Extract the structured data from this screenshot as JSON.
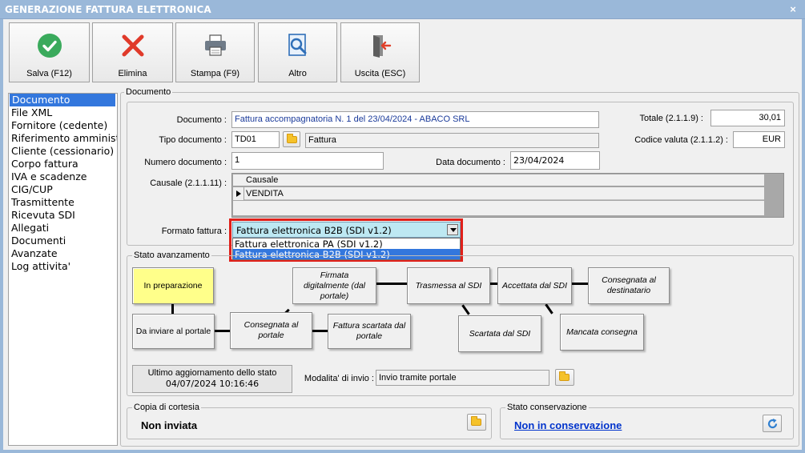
{
  "window": {
    "title": "GENERAZIONE FATTURA ELETTRONICA",
    "close": "×"
  },
  "toolbar": [
    {
      "label": "Salva (F12)",
      "icon": "check-circle"
    },
    {
      "label": "Elimina",
      "icon": "x-mark"
    },
    {
      "label": "Stampa (F9)",
      "icon": "printer"
    },
    {
      "label": "Altro",
      "icon": "search-document"
    },
    {
      "label": "Uscita (ESC)",
      "icon": "exit-door"
    }
  ],
  "nav": [
    "Documento",
    "File XML",
    "Fornitore (cedente)",
    "Riferimento amministrativo",
    "Cliente (cessionario)",
    "Corpo fattura",
    "IVA e scadenze",
    "CIG/CUP",
    "Trasmittente",
    "Ricevuta SDI",
    "Allegati",
    "Documenti",
    "Avanzate",
    "Log attivita'"
  ],
  "documento": {
    "legend": "Documento",
    "documento_label": "Documento :",
    "documento_value": "Fattura accompagnatoria N. 1 del 23/04/2024 - ABACO SRL",
    "tipo_label": "Tipo documento :",
    "tipo_code": "TD01",
    "tipo_desc": "Fattura",
    "numero_label": "Numero documento :",
    "numero_value": "1",
    "data_label": "Data documento :",
    "data_value": "23/04/2024",
    "totale_label": "Totale (2.1.1.9) :",
    "totale_value": "30,01",
    "valuta_label": "Codice valuta (2.1.1.2) :",
    "valuta_value": "EUR",
    "causale_label": "Causale (2.1.1.11) :",
    "causale_header": "Causale",
    "causale_row": "VENDITA",
    "formato_label": "Formato fattura :",
    "formato_value": "Fattura elettronica B2B (SDI v1.2)",
    "formato_options": [
      "Fattura elettronica PA (SDI v1.2)",
      "Fattura elettronica B2B (SDI v1.2)"
    ]
  },
  "stato": {
    "legend": "Stato avanzamento",
    "steps": {
      "in_preparazione": "In preparazione",
      "da_inviare": "Da inviare al portale",
      "consegnata_portale": "Consegnata al portale",
      "firmata": "Firmata digitalmente (dal portale)",
      "scartata_portale": "Fattura scartata dal portale",
      "trasmessa": "Trasmessa al SDI",
      "scartata_sdi": "Scartata dal SDI",
      "accettata": "Accettata dal SDI",
      "mancata": "Mancata consegna",
      "consegnata_dest": "Consegnata al destinatario"
    },
    "ultimo_label": "Ultimo aggiornamento dello stato",
    "ultimo_value": "04/07/2024 10:16:46",
    "modalita_label": "Modalita' di invio :",
    "modalita_value": "Invio tramite portale"
  },
  "copia": {
    "legend": "Copia di cortesia",
    "value": "Non inviata"
  },
  "conservazione": {
    "legend": "Stato conservazione",
    "value": "Non in conservazione"
  },
  "colors": {
    "title_bar": "#9ab8d9",
    "selection": "#3377dd",
    "active_step": "#ffff8a",
    "dropdown_bg": "#bde8f2",
    "highlight_border": "#e0201a",
    "link": "#0033cc"
  }
}
